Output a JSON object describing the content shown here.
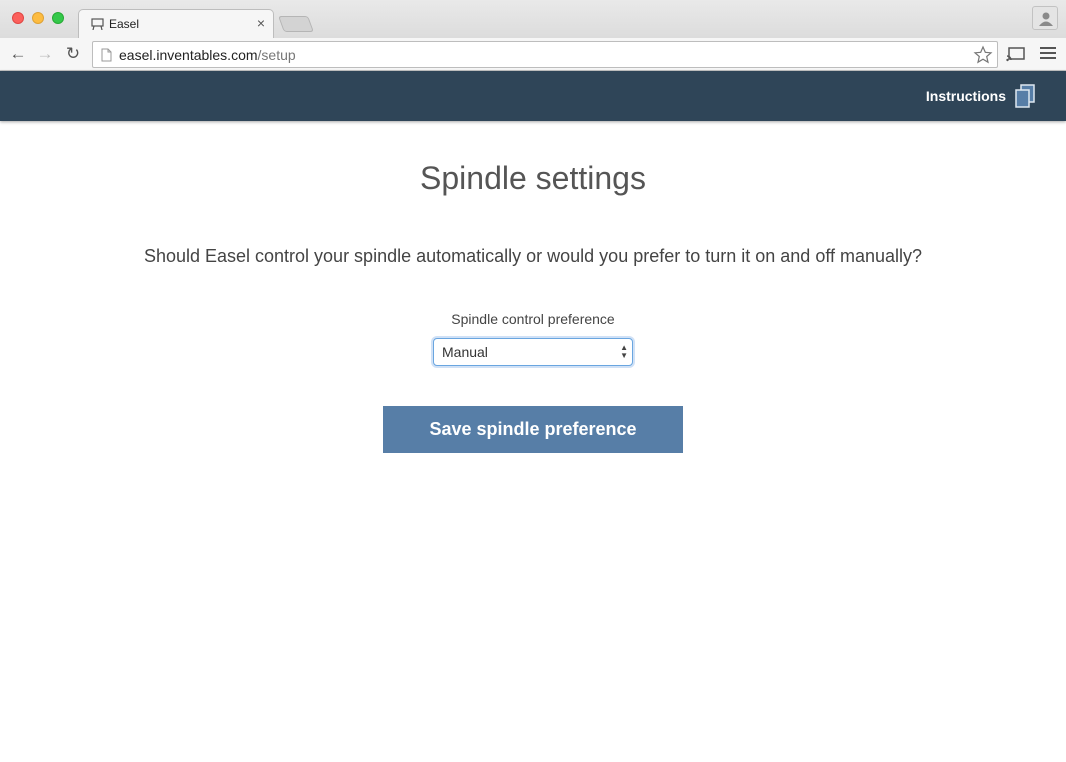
{
  "browser": {
    "tab_title": "Easel",
    "tab_close": "×",
    "url_host": "easel.inventables.com",
    "url_path": "/setup",
    "back": "←",
    "forward": "→",
    "reload": "↻"
  },
  "header": {
    "instructions_label": "Instructions",
    "background_color": "#2f4558"
  },
  "main": {
    "title": "Spindle settings",
    "question": "Should Easel control your spindle automatically or would you prefer to turn it on and off manually?",
    "field_label": "Spindle control preference",
    "select_value": "Manual",
    "save_button": "Save spindle preference",
    "button_color": "#577ea7"
  }
}
